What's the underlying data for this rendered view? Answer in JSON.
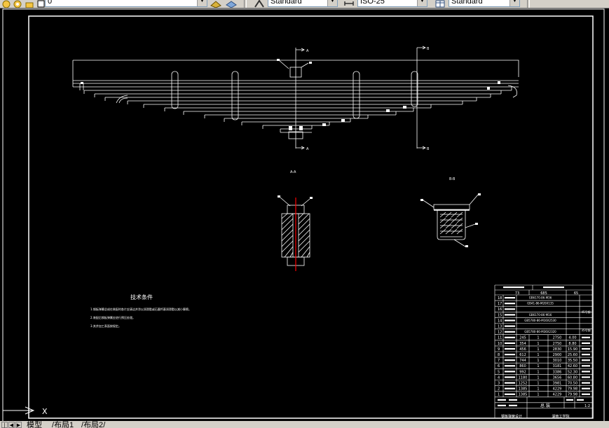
{
  "toolbar": {
    "layer_value": "0",
    "text_style": "Standard",
    "dim_style": "ISO-25",
    "table_style": "Standard"
  },
  "drawing": {
    "section_labels": {
      "a": "A",
      "b": "B",
      "aa": "A-A",
      "bb": "B-B"
    },
    "notes_title": "技术条件",
    "notes": [
      "1.钢板弹簧总成在装配时各片应清洁并涂以润滑脂或石墨钙基润滑脂以减小摩擦。",
      "2.装配后钢板弹簧应进行预压处理。",
      "3.其余加工表面按规定。"
    ],
    "bom_header": [
      "73",
      "685",
      "65"
    ],
    "bom_rows": [
      {
        "no": "18",
        "desc": "GB6170-86-M36"
      },
      {
        "no": "17",
        "desc": "GB41-86-M20X135"
      },
      {
        "no": "16",
        "desc": ""
      },
      {
        "no": "15",
        "desc": "GB6170-86-M16"
      },
      {
        "no": "14",
        "desc": "GB5780-86-M16X2530"
      },
      {
        "no": "13",
        "desc": ""
      },
      {
        "no": "12",
        "desc": "GB5780-86-M36X2320"
      },
      {
        "no": "11",
        "len": "245",
        "qty": "1",
        "w": "2750",
        "m": "4.00"
      },
      {
        "no": "10",
        "len": "354",
        "qty": "1",
        "w": "2750",
        "m": "8.80"
      },
      {
        "no": "9",
        "len": "456",
        "qty": "1",
        "w": "2830",
        "m": "15.90"
      },
      {
        "no": "8",
        "len": "612",
        "qty": "1",
        "w": "2900",
        "m": "25.60"
      },
      {
        "no": "7",
        "len": "744",
        "qty": "1",
        "w": "3010",
        "m": "35.50"
      },
      {
        "no": "6",
        "len": "860",
        "qty": "1",
        "w": "3181",
        "m": "42.60"
      },
      {
        "no": "5",
        "len": "992",
        "qty": "1",
        "w": "3386",
        "m": "52.30"
      },
      {
        "no": "4",
        "len": "1180",
        "qty": "1",
        "w": "3656",
        "m": "60.80"
      },
      {
        "no": "3",
        "len": "1252",
        "qty": "1",
        "w": "3981",
        "m": "70.50"
      },
      {
        "no": "2",
        "len": "1385",
        "qty": "1",
        "w": "4229",
        "m": "79.98"
      },
      {
        "no": "1",
        "len": "1385",
        "qty": "1",
        "w": "4229",
        "m": "79.98"
      }
    ],
    "bom_side_notes": [
      "45号钢",
      "35号钢"
    ],
    "assembly_label": "总 装",
    "scale": "1:2",
    "title_left": "钢板弹簧设计",
    "title_right": "湖南工学院"
  },
  "ucs": {
    "x_label": "X"
  },
  "tabs": {
    "model": "模型",
    "layout1": "布局1",
    "layout2": "布局2"
  }
}
